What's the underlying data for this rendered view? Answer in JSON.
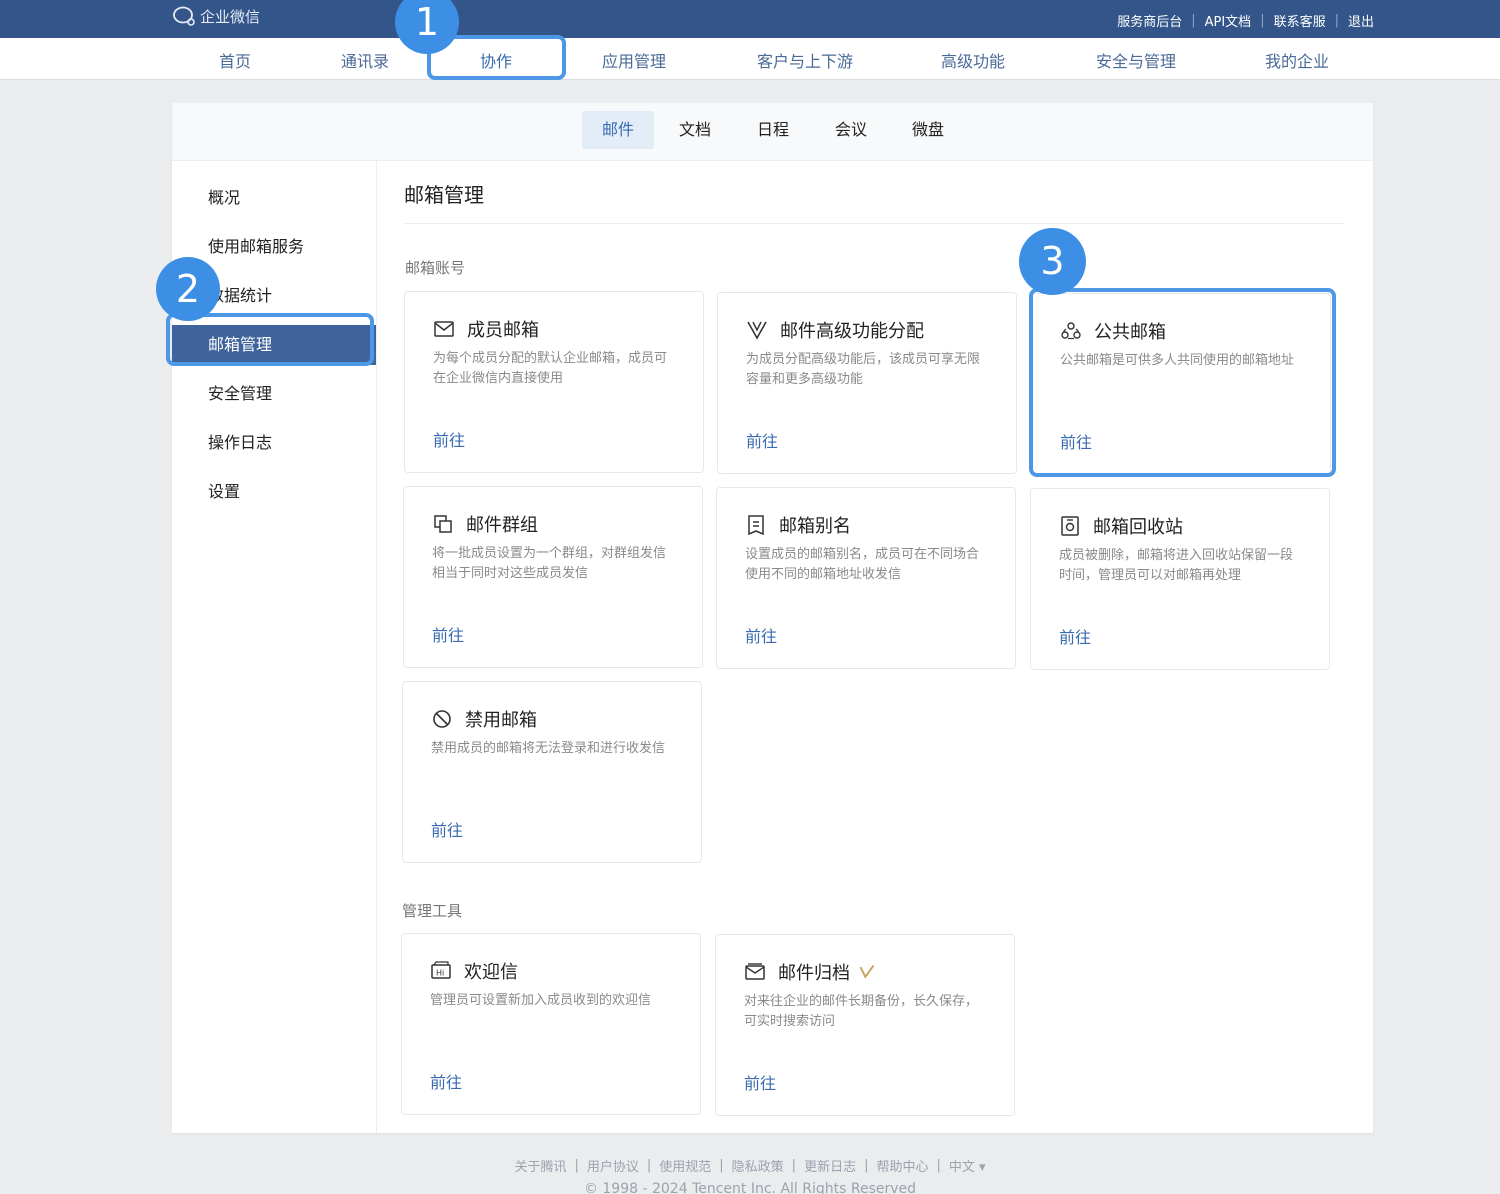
{
  "app": {
    "logo_text": "企业微信"
  },
  "top_links": [
    "服务商后台",
    "API文档",
    "联系客服",
    "退出"
  ],
  "main_nav": [
    "首页",
    "通讯录",
    "协作",
    "应用管理",
    "客户与上下游",
    "高级功能",
    "安全与管理",
    "我的企业"
  ],
  "main_nav_active": "协作",
  "sub_nav": [
    "邮件",
    "文档",
    "日程",
    "会议",
    "微盘"
  ],
  "sub_nav_active": "邮件",
  "sidebar": [
    "概况",
    "使用邮箱服务",
    "数据统计",
    "邮箱管理",
    "安全管理",
    "操作日志",
    "设置"
  ],
  "sidebar_active": "邮箱管理",
  "page_title": "邮箱管理",
  "sections": {
    "accounts_label": "邮箱账号",
    "tools_label": "管理工具"
  },
  "cards": [
    {
      "title": "成员邮箱",
      "desc": "为每个成员分配的默认企业邮箱，成员可在企业微信内直接使用",
      "link": "前往",
      "icon": "mail-icon"
    },
    {
      "title": "邮件高级功能分配",
      "desc": "为成员分配高级功能后，该成员可享无限容量和更多高级功能",
      "link": "前往",
      "icon": "v-badge-icon"
    },
    {
      "title": "公共邮箱",
      "desc": "公共邮箱是可供多人共同使用的邮箱地址",
      "link": "前往",
      "icon": "shared-people-icon"
    },
    {
      "title": "邮件群组",
      "desc": "将一批成员设置为一个群组，对群组发信相当于同时对这些成员发信",
      "link": "前往",
      "icon": "group-icon"
    },
    {
      "title": "邮箱别名",
      "desc": "设置成员的邮箱别名，成员可在不同场合使用不同的邮箱地址收发信",
      "link": "前往",
      "icon": "alias-icon"
    },
    {
      "title": "邮箱回收站",
      "desc": "成员被删除，邮箱将进入回收站保留一段时间，管理员可以对邮箱再处理",
      "link": "前往",
      "icon": "recycle-icon"
    },
    {
      "title": "禁用邮箱",
      "desc": "禁用成员的邮箱将无法登录和进行收发信",
      "link": "前往",
      "icon": "ban-icon"
    }
  ],
  "tool_cards": [
    {
      "title": "欢迎信",
      "desc": "管理员可设置新加入成员收到的欢迎信",
      "link": "前往",
      "icon": "hi-icon"
    },
    {
      "title": "邮件归档",
      "desc": "对来往企业的邮件长期备份，长久保存，可实时搜索访问",
      "link": "前往",
      "icon": "archive-mail-icon"
    }
  ],
  "badges": [
    "1",
    "2",
    "3"
  ],
  "footer": {
    "links": [
      "关于腾讯",
      "用户协议",
      "使用规范",
      "隐私政策",
      "更新日志",
      "帮助中心",
      "中文 ▾"
    ],
    "copyright": "© 1998 - 2024 Tencent Inc. All Rights Reserved"
  },
  "colors": {
    "topbar": "#33558a",
    "accent": "#3a6bb0",
    "highlight": "#4e96e6",
    "sidebar_active": "#3f649c"
  }
}
